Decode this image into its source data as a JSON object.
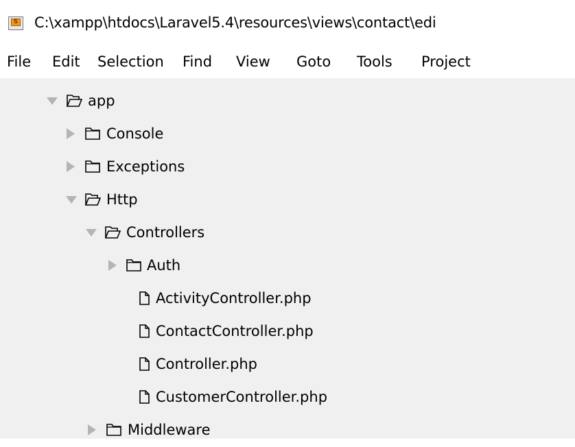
{
  "window": {
    "title": "C:\\xampp\\htdocs\\Laravel5.4\\resources\\views\\contact\\edi",
    "app_icon_letter": "S"
  },
  "menu": [
    "File",
    "Edit",
    "Selection",
    "Find",
    "View",
    "Goto",
    "Tools",
    "Project"
  ],
  "tree": [
    {
      "label": "app",
      "type": "folder",
      "state": "expanded"
    },
    {
      "label": "Console",
      "type": "folder",
      "state": "collapsed"
    },
    {
      "label": "Exceptions",
      "type": "folder",
      "state": "collapsed"
    },
    {
      "label": "Http",
      "type": "folder",
      "state": "expanded"
    },
    {
      "label": "Controllers",
      "type": "folder",
      "state": "expanded"
    },
    {
      "label": "Auth",
      "type": "folder",
      "state": "collapsed"
    },
    {
      "label": "ActivityController.php",
      "type": "file"
    },
    {
      "label": "ContactController.php",
      "type": "file"
    },
    {
      "label": "Controller.php",
      "type": "file"
    },
    {
      "label": "CustomerController.php",
      "type": "file"
    },
    {
      "label": "Middleware",
      "type": "folder",
      "state": "collapsed"
    }
  ],
  "colors": {
    "sidebar_bg": "#f0f0f0",
    "disclosure_arrow": "#b4b4b4",
    "text": "#000000"
  }
}
